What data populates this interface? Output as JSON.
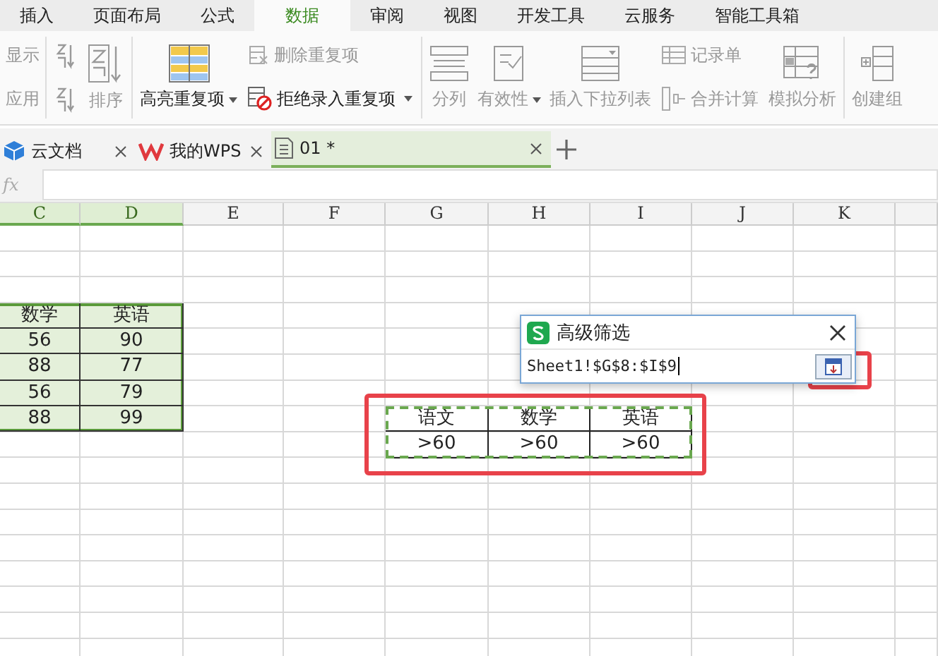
{
  "menu_tabs": [
    {
      "label": "插入",
      "selected": false
    },
    {
      "label": "页面布局",
      "selected": false
    },
    {
      "label": "公式",
      "selected": false
    },
    {
      "label": "数据",
      "selected": true
    },
    {
      "label": "审阅",
      "selected": false
    },
    {
      "label": "视图",
      "selected": false
    },
    {
      "label": "开发工具",
      "selected": false
    },
    {
      "label": "云服务",
      "selected": false
    },
    {
      "label": "智能工具箱",
      "selected": false
    }
  ],
  "ribbon": {
    "groups": [
      {
        "columns": [
          [
            {
              "label": "显示",
              "kind": "plain",
              "disabled": true
            },
            {
              "label": "应用",
              "kind": "plain",
              "disabled": true
            }
          ]
        ]
      },
      {
        "columns": [
          [
            {
              "kind": "sortup",
              "disabled": true,
              "dropdown": false
            },
            {
              "kind": "sortdown",
              "disabled": true,
              "dropdown": false
            }
          ],
          [
            {
              "label": "排序",
              "kind": "sort",
              "disabled": true,
              "dropdown": false
            }
          ]
        ]
      },
      {
        "columns": [
          [
            {
              "label": "高亮重复项",
              "kind": "highlight",
              "disabled": false,
              "dropdown": true
            }
          ],
          [
            {
              "label": "删除重复项",
              "kind": "remove",
              "disabled": true,
              "dropdown": false
            },
            {
              "label": "拒绝录入重复项",
              "kind": "reject",
              "disabled": false,
              "dropdown": true
            }
          ]
        ]
      },
      {
        "columns": [
          [
            {
              "label": "分列",
              "kind": "split",
              "disabled": true,
              "dropdown": false
            }
          ],
          [
            {
              "label": "有效性",
              "kind": "validate",
              "disabled": true,
              "dropdown": true
            }
          ],
          [
            {
              "label": "插入下拉列表",
              "kind": "droplist",
              "disabled": true,
              "dropdown": false
            }
          ],
          [
            {
              "label": "记录单",
              "kind": "record",
              "disabled": true,
              "dropdown": false
            },
            {
              "label": "合并计算",
              "kind": "merge",
              "disabled": true,
              "dropdown": false
            }
          ],
          [
            {
              "label": "模拟分析",
              "kind": "simulate",
              "disabled": true,
              "dropdown": false
            }
          ]
        ]
      },
      {
        "columns": [
          [
            {
              "label": "创建组",
              "kind": "group",
              "disabled": true,
              "dropdown": false
            }
          ]
        ]
      }
    ]
  },
  "doc_tabs": [
    {
      "label": "云文档",
      "kind": "cloud",
      "selected": false
    },
    {
      "label": "我的WPS",
      "kind": "wps",
      "selected": false
    },
    {
      "label": "01 *",
      "kind": "sheet",
      "selected": true
    }
  ],
  "formula_bar": {
    "label": "fx"
  },
  "column_headers": [
    {
      "label": "C",
      "selected": true
    },
    {
      "label": "D",
      "selected": true
    },
    {
      "label": "E",
      "selected": false
    },
    {
      "label": "F",
      "selected": false
    },
    {
      "label": "G",
      "selected": false
    },
    {
      "label": "H",
      "selected": false
    },
    {
      "label": "I",
      "selected": false
    },
    {
      "label": "J",
      "selected": false
    },
    {
      "label": "K",
      "selected": false
    }
  ],
  "data_table": {
    "columns": [
      "数学",
      "英语"
    ],
    "rows": [
      [
        "56",
        "90"
      ],
      [
        "88",
        "77"
      ],
      [
        "56",
        "79"
      ],
      [
        "88",
        "99"
      ]
    ]
  },
  "criteria_table": {
    "columns": [
      "语文",
      "数学",
      "英语"
    ],
    "values": [
      ">60",
      ">60",
      ">60"
    ]
  },
  "dialog": {
    "title": "高级筛选",
    "value": "Sheet1!$G$8:$I$9"
  }
}
